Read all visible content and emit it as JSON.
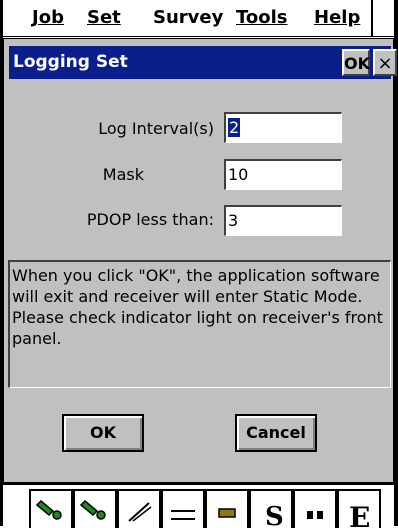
{
  "menu": {
    "items": [
      {
        "label": "Job"
      },
      {
        "label": "Set"
      },
      {
        "label": "Survey"
      },
      {
        "label": "Tools"
      },
      {
        "label": "Help"
      }
    ]
  },
  "dialog": {
    "title": "Logging Set",
    "title_ok": "OK",
    "title_close": "×",
    "fields": {
      "log_interval": {
        "label": "Log Interval(s)",
        "value": "2"
      },
      "mask": {
        "label": "Mask",
        "value": "10"
      },
      "pdop": {
        "label": "PDOP less than:",
        "value": "3"
      }
    },
    "info_text": "When you click \"OK\", the application software will exit and receiver will enter Static Mode. Please check indicator light on receiver's front panel.",
    "ok_label": "OK",
    "cancel_label": "Cancel"
  },
  "toolbar": {
    "icons": [
      "wrench-icon",
      "wrench-icon",
      "pencil-icon",
      "list-icon",
      "satellite-icon",
      "s-icon",
      "binoculars-icon",
      "e-icon"
    ]
  },
  "colors": {
    "title_bar": "#0a1f8c",
    "dialog_bg": "#c0c0c0",
    "icon_green": "#1a8a1a"
  }
}
